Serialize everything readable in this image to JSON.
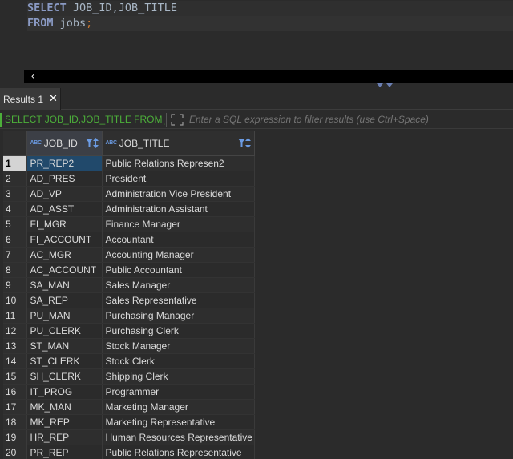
{
  "editor": {
    "line1": {
      "keyword": "SELECT",
      "rest": " JOB_ID,JOB_TITLE"
    },
    "line2": {
      "keyword": "FROM",
      "rest": " jobs",
      "terminator": ";"
    }
  },
  "results_tab": {
    "label": "Results 1",
    "close": "✕"
  },
  "filter": {
    "query": "SELECT JOB_ID,JOB_TITLE FROM jobs",
    "placeholder": "Enter a SQL expression to filter results (use Ctrl+Space)"
  },
  "grid": {
    "columns": [
      {
        "type_badge": "ABC",
        "name": "JOB_ID"
      },
      {
        "type_badge": "ABC",
        "name": "JOB_TITLE"
      }
    ],
    "rows": [
      [
        "1",
        "PR_REP2",
        "Public Relations Represen2"
      ],
      [
        "2",
        "AD_PRES",
        "President"
      ],
      [
        "3",
        "AD_VP",
        "Administration Vice President"
      ],
      [
        "4",
        "AD_ASST",
        "Administration Assistant"
      ],
      [
        "5",
        "FI_MGR",
        "Finance Manager"
      ],
      [
        "6",
        "FI_ACCOUNT",
        "Accountant"
      ],
      [
        "7",
        "AC_MGR",
        "Accounting Manager"
      ],
      [
        "8",
        "AC_ACCOUNT",
        "Public Accountant"
      ],
      [
        "9",
        "SA_MAN",
        "Sales Manager"
      ],
      [
        "10",
        "SA_REP",
        "Sales Representative"
      ],
      [
        "11",
        "PU_MAN",
        "Purchasing Manager"
      ],
      [
        "12",
        "PU_CLERK",
        "Purchasing Clerk"
      ],
      [
        "13",
        "ST_MAN",
        "Stock Manager"
      ],
      [
        "14",
        "ST_CLERK",
        "Stock Clerk"
      ],
      [
        "15",
        "SH_CLERK",
        "Shipping Clerk"
      ],
      [
        "16",
        "IT_PROG",
        "Programmer"
      ],
      [
        "17",
        "MK_MAN",
        "Marketing Manager"
      ],
      [
        "18",
        "MK_REP",
        "Marketing Representative"
      ],
      [
        "19",
        "HR_REP",
        "Human Resources Representative"
      ],
      [
        "20",
        "PR_REP",
        "Public Relations Representative"
      ]
    ],
    "selected_row": 0
  },
  "colors": {
    "accent_green": "#4caf3a",
    "selection_blue": "#21496b",
    "keyword": "#8a9ac4",
    "filter_icon": "#6b9be3"
  }
}
